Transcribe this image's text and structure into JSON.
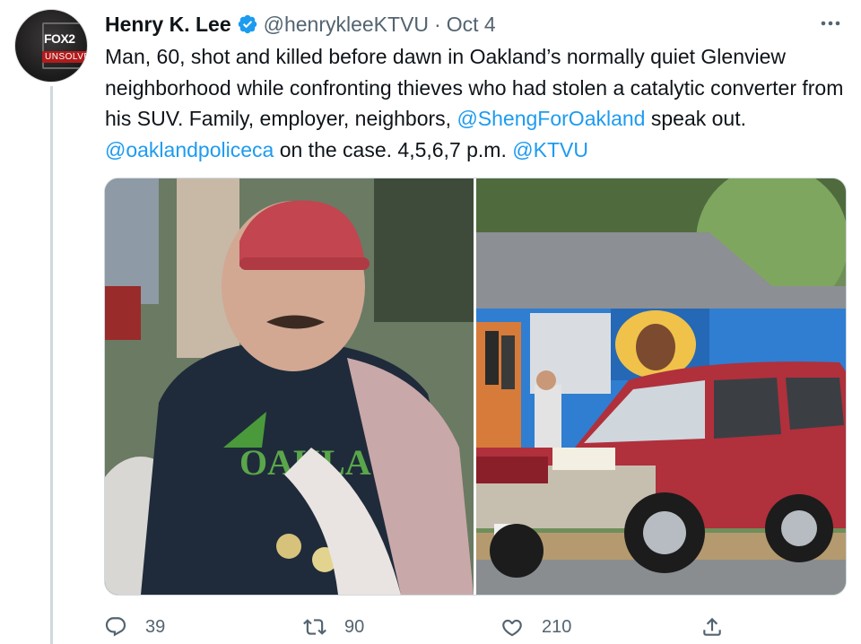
{
  "tweet": {
    "author_name": "Henry K. Lee",
    "handle": "@henrykleeKTVU",
    "separator": "·",
    "date": "Oct 4",
    "avatar_text": {
      "brand": "FOX2",
      "badge": "UNSOLVED"
    },
    "text_parts": [
      {
        "type": "text",
        "value": "Man, 60, shot and killed before dawn in Oakland’s normally quiet Glenview neighborhood while confronting thieves who had stolen a catalytic converter from his SUV. Family, employer, neighbors, "
      },
      {
        "type": "link",
        "value": "@ShengForOakland"
      },
      {
        "type": "text",
        "value": " speak out. "
      },
      {
        "type": "link",
        "value": "@oaklandpoliceca"
      },
      {
        "type": "text",
        "value": " on the case. 4,5,6,7  p.m. "
      },
      {
        "type": "link",
        "value": "@KTVU"
      }
    ],
    "photo_left_shirt_text": "OAKLA",
    "actions": {
      "replies": "39",
      "retweets": "90",
      "likes": "210"
    }
  },
  "colors": {
    "link": "#1d9bf0",
    "secondary_text": "#536471",
    "verified": "#1d9bf0",
    "divider": "#cfd9de"
  },
  "icons": {
    "verified": "verified-badge-icon",
    "more": "more-dots-icon",
    "reply": "reply-icon",
    "retweet": "retweet-icon",
    "like": "heart-icon",
    "share": "share-icon"
  }
}
